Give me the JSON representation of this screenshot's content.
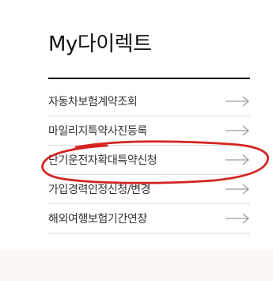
{
  "panel": {
    "title": "My다이렉트"
  },
  "menu": {
    "items": [
      {
        "label": "자동차보험계약조회",
        "icon": "arrow-right-icon"
      },
      {
        "label": "마일리지특약사진등록",
        "icon": "arrow-right-icon"
      },
      {
        "label": "단기운전자확대특약신청",
        "icon": "arrow-right-icon"
      },
      {
        "label": "가입경력인정신청/변경",
        "icon": "arrow-right-icon"
      },
      {
        "label": "해외여행보험기간연장",
        "icon": "arrow-right-icon"
      }
    ]
  },
  "annotation": {
    "color": "#d32420",
    "target": "단기운전자확대특약신청"
  },
  "colors": {
    "title_rule": "#111111",
    "divider": "#dcdcdc",
    "bottom_band": "#fdf7f3"
  }
}
